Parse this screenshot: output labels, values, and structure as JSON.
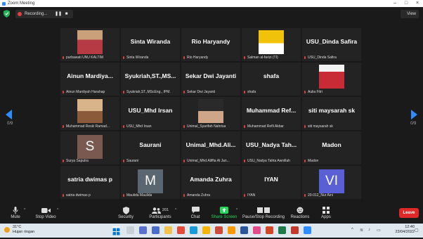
{
  "window": {
    "title": "Zoom Meeting"
  },
  "topbar": {
    "recording_label": "Recording...",
    "view_label": "View"
  },
  "pagination": {
    "left": "0/9",
    "right": "0/9"
  },
  "tiles": [
    {
      "type": "photo",
      "name": "",
      "label": "purbawati UNU KALTIM",
      "muted": true
    },
    {
      "type": "name",
      "name": "Sinta Wiranda",
      "label": "Sinta Wiranda",
      "muted": true
    },
    {
      "type": "name",
      "name": "Rio Haryandy",
      "label": "Rio Haryandy",
      "muted": true
    },
    {
      "type": "photo",
      "name": "",
      "label": "Salman al-farizi (TI)",
      "muted": true
    },
    {
      "type": "name",
      "name": "USU_Dinda Safira",
      "label": "USU_Dinda Safira",
      "muted": true
    },
    {
      "type": "name",
      "name": "Ainun Mardiya...",
      "label": "Ainun Mardiyah Harahap",
      "muted": true
    },
    {
      "type": "name",
      "name": "Syukriah,ST.,MS...",
      "label": "Syukriah,ST.,MScEng., IPM.",
      "muted": true
    },
    {
      "type": "name",
      "name": "Sekar Dwi Jayanti",
      "label": "Sekar Dwi Jayanti",
      "muted": true
    },
    {
      "type": "name",
      "name": "shafa",
      "label": "shafa",
      "muted": true
    },
    {
      "type": "photo",
      "name": "",
      "label": "Aulia Fitri",
      "muted": true
    },
    {
      "type": "photo",
      "name": "",
      "label": "Muhammad Reski Ramad...",
      "muted": true
    },
    {
      "type": "name",
      "name": "USU_Mhd Irsan",
      "label": "USU_Mhd Irsan",
      "muted": true
    },
    {
      "type": "photo",
      "name": "",
      "label": "Unimal_Syarifah Nahrisa",
      "muted": true
    },
    {
      "type": "name",
      "name": "Muhammad Ref...",
      "label": "Muhammad Refli Akbar",
      "muted": true
    },
    {
      "type": "name",
      "name": "siti maysarah sk",
      "label": "siti maysarah sk",
      "muted": true
    },
    {
      "type": "avatar",
      "name": "S",
      "label": "Surya Saputra",
      "muted": true,
      "color": "#7a5a50"
    },
    {
      "type": "name",
      "name": "Saurani",
      "label": "Saurani",
      "muted": true
    },
    {
      "type": "name",
      "name": "Unimal_Mhd.Ali...",
      "label": "Unimal_Mhd.Aliffia Al Jan...",
      "muted": true
    },
    {
      "type": "name",
      "name": "USU_Nadya Tah...",
      "label": "USU_Nadya Tahta Awnillah",
      "muted": true
    },
    {
      "type": "name",
      "name": "Madon",
      "label": "Madon",
      "muted": true
    },
    {
      "type": "name",
      "name": "satria dwimas p",
      "label": "satria dwimas p",
      "muted": true
    },
    {
      "type": "avatar",
      "name": "M",
      "label": "Maulida Maulida",
      "muted": true,
      "color": "#5a6670"
    },
    {
      "type": "name",
      "name": "Amanda Zuhra",
      "label": "Amanda Zuhra",
      "muted": true
    },
    {
      "type": "name",
      "name": "IYAN",
      "label": "IYAN",
      "muted": true
    },
    {
      "type": "avatar",
      "name": "VI",
      "label": "20-012_Nur Aini",
      "muted": true,
      "color": "#5b5fd6"
    }
  ],
  "toolbar": {
    "mute": "Mute",
    "stop_video": "Stop Video",
    "security": "Security",
    "participants": "Participants",
    "participants_count": "201",
    "chat": "Chat",
    "share_screen": "Share Screen",
    "pause_recording": "Pause/Stop Recording",
    "reactions": "Reactions",
    "apps": "Apps",
    "leave": "Leave"
  },
  "taskbar": {
    "temperature": "31°C",
    "weather": "Hujan ringan",
    "time": "12:40",
    "date": "23/04/2022"
  },
  "colors": {
    "accent_blue": "#2d8cff",
    "leave_red": "#e02828",
    "share_green": "#23d959",
    "muted_red": "#e34040"
  }
}
